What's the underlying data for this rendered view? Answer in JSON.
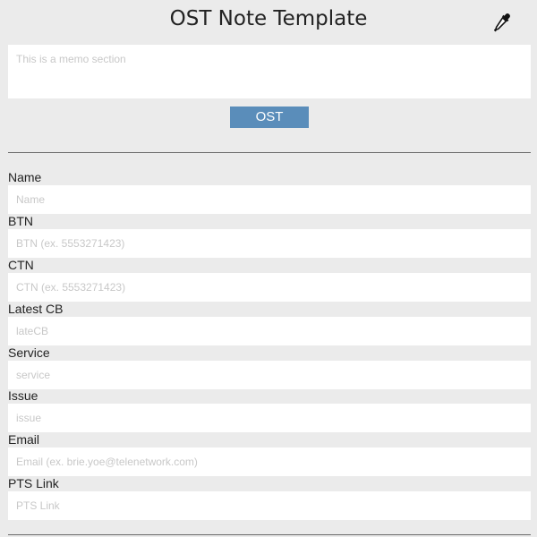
{
  "header": {
    "title": "OST Note Template",
    "color_picker_icon": "eyedropper-icon"
  },
  "memo": {
    "placeholder": "This is a memo section",
    "value": ""
  },
  "ost_button": {
    "label": "OST",
    "color": "#5a8dba"
  },
  "fields": [
    {
      "label": "Name",
      "placeholder": "Name",
      "value": ""
    },
    {
      "label": "BTN",
      "placeholder": "BTN (ex. 5553271423)",
      "value": ""
    },
    {
      "label": "CTN",
      "placeholder": "CTN (ex. 5553271423)",
      "value": ""
    },
    {
      "label": "Latest CB",
      "placeholder": "lateCB",
      "value": ""
    },
    {
      "label": "Service",
      "placeholder": "service",
      "value": ""
    },
    {
      "label": "Issue",
      "placeholder": "issue",
      "value": ""
    },
    {
      "label": "Email",
      "placeholder": "Email (ex. brie.yoe@telenetwork.com)",
      "value": ""
    },
    {
      "label": "PTS Link",
      "placeholder": "PTS Link",
      "value": ""
    }
  ]
}
